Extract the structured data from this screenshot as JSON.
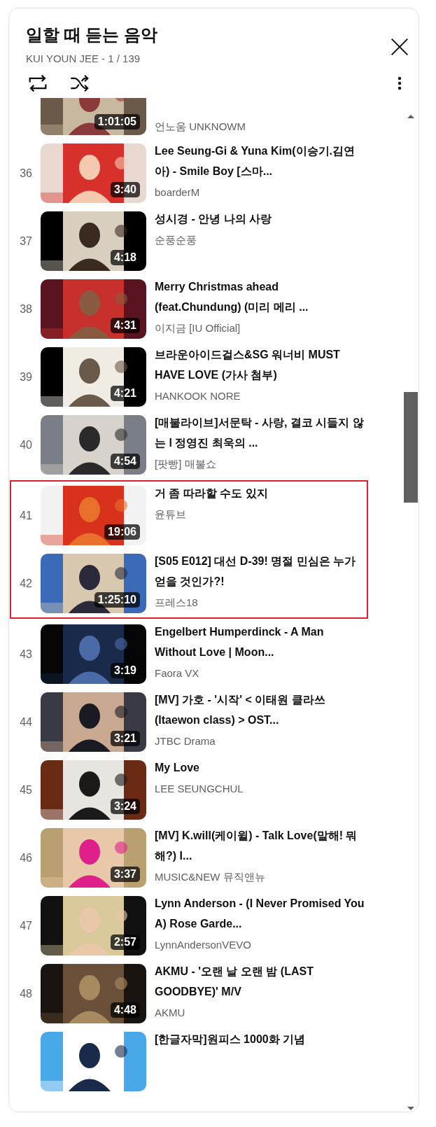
{
  "header": {
    "title": "일할 때 듣는 음악",
    "subtitle": "KUI YOUN JEE - 1 / 139"
  },
  "items": [
    {
      "channel": "언노움 UNKNOWM",
      "duration": "1:01:05",
      "highlighted": false
    },
    {
      "number": "36",
      "title": "Lee Seung-Gi & Yuna Kim(이승기.김연아) - Smile Boy [스마...",
      "channel": "boarderM",
      "duration": "3:40",
      "highlighted": false
    },
    {
      "number": "37",
      "title": "성시경 - 안녕 나의 사랑",
      "channel": "순풍순풍",
      "duration": "4:18",
      "highlighted": false
    },
    {
      "number": "38",
      "title": "Merry Christmas ahead (feat.Chundung) (미리 메리 ...",
      "channel": "이지금 [IU Official]",
      "duration": "4:31",
      "highlighted": false
    },
    {
      "number": "39",
      "title": "브라운아이드걸스&SG 워너비 MUST HAVE LOVE (가사 첨부)",
      "channel": "HANKOOK NORE",
      "duration": "4:21",
      "highlighted": false
    },
    {
      "number": "40",
      "title": "[매불라이브]서문탁 - 사랑, 결코 시들지 않는 l 정영진 최욱의 ...",
      "channel": "[팟빵] 매불쇼",
      "duration": "4:54",
      "highlighted": false
    },
    {
      "number": "41",
      "title": "거 좀 따라할 수도 있지",
      "channel": "윤튜브",
      "duration": "19:06",
      "highlighted": true
    },
    {
      "number": "42",
      "title": "[S05 E012] 대선 D-39! 명절 민심은 누가 얻을 것인가?!",
      "channel": "프레스18",
      "duration": "1:25:10",
      "highlighted": true
    },
    {
      "number": "43",
      "title": "Engelbert Humperdinck - A Man Without Love | Moon...",
      "channel": "Faora VX",
      "duration": "3:19",
      "highlighted": false
    },
    {
      "number": "44",
      "title": "[MV] 가호 - '시작' < 이태원 클라쓰(Itaewon class) > OST...",
      "channel": "JTBC Drama",
      "duration": "3:21",
      "highlighted": false
    },
    {
      "number": "45",
      "title": "My Love",
      "channel": "LEE SEUNGCHUL",
      "duration": "3:24",
      "highlighted": false
    },
    {
      "number": "46",
      "title": "[MV] K.will(케이윌) - Talk Love(말해! 뭐해?) I...",
      "channel": "MUSIC&NEW 뮤직앤뉴",
      "duration": "3:37",
      "highlighted": false
    },
    {
      "number": "47",
      "title": "Lynn Anderson - (I Never Promised You A) Rose Garde...",
      "channel": "LynnAndersonVEVO",
      "duration": "2:57",
      "highlighted": false
    },
    {
      "number": "48",
      "title": "AKMU - '오랜 날 오랜 밤 (LAST GOODBYE)' M/V",
      "channel": "AKMU",
      "duration": "4:48",
      "highlighted": false
    },
    {
      "title": "[한글자막]원피스 1000화 기념",
      "highlighted": false
    }
  ]
}
